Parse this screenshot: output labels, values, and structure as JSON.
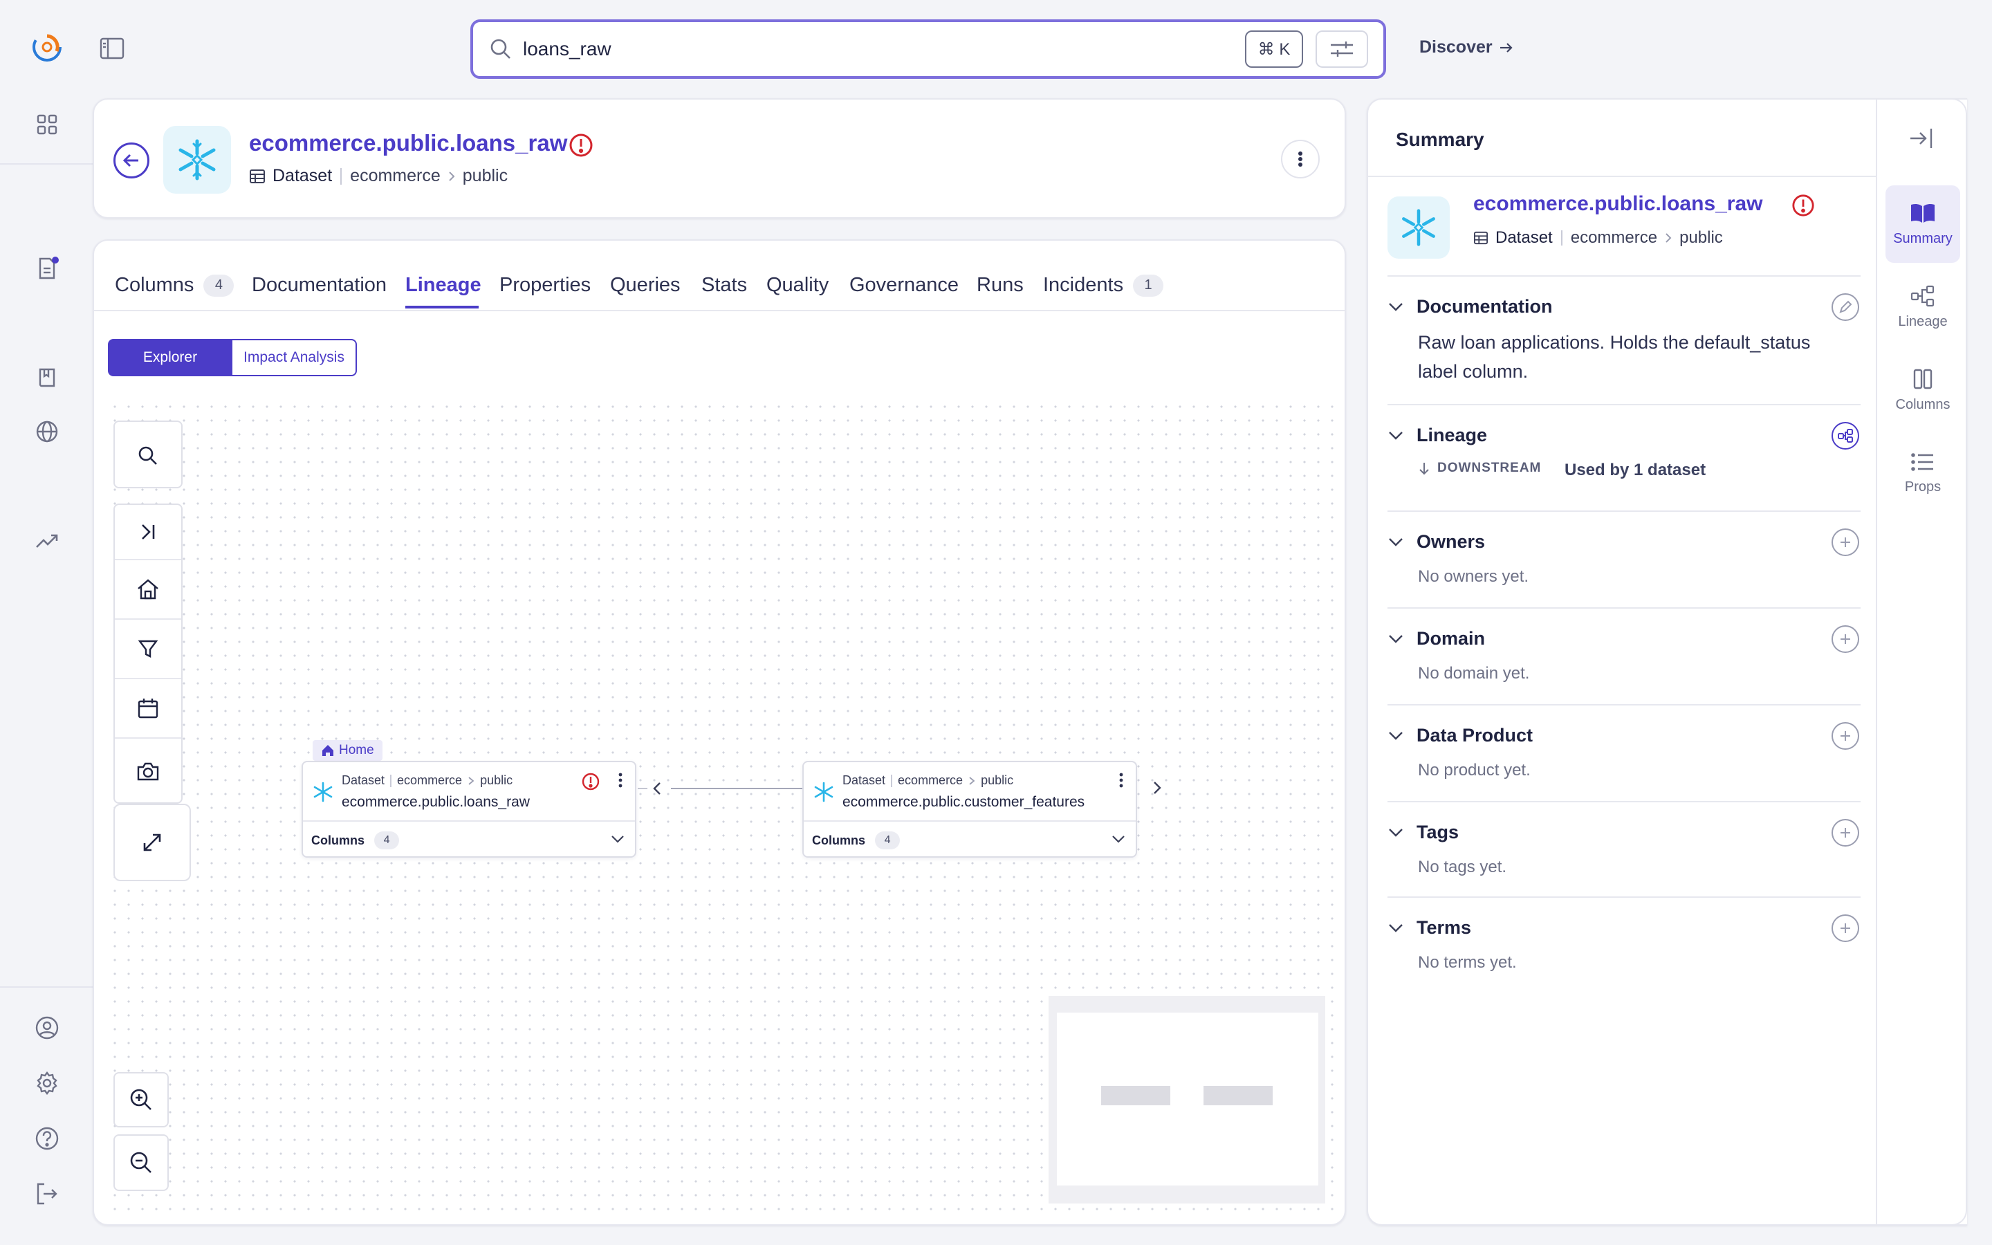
{
  "search": {
    "query": "loans_raw",
    "shortcut": "⌘ K"
  },
  "topbar": {
    "discover_label": "Discover"
  },
  "entity": {
    "title": "ecommerce.public.loans_raw",
    "type": "Dataset",
    "namespace": "ecommerce",
    "schema": "public"
  },
  "tabs": [
    {
      "label": "Columns",
      "count": "4"
    },
    {
      "label": "Documentation"
    },
    {
      "label": "Lineage",
      "active": true
    },
    {
      "label": "Properties"
    },
    {
      "label": "Queries"
    },
    {
      "label": "Stats"
    },
    {
      "label": "Quality"
    },
    {
      "label": "Governance"
    },
    {
      "label": "Runs"
    },
    {
      "label": "Incidents",
      "count": "1"
    }
  ],
  "lineage": {
    "modes": [
      "Explorer",
      "Impact Analysis"
    ],
    "home_tag": "Home",
    "nodes": [
      {
        "type": "Dataset",
        "namespace": "ecommerce",
        "schema": "public",
        "name": "ecommerce.public.loans_raw",
        "columns_label": "Columns",
        "columns_count": "4"
      },
      {
        "type": "Dataset",
        "namespace": "ecommerce",
        "schema": "public",
        "name": "ecommerce.public.customer_features",
        "columns_label": "Columns",
        "columns_count": "4"
      }
    ]
  },
  "summary": {
    "title": "Summary",
    "documentation": {
      "label": "Documentation",
      "text": "Raw loan applications. Holds the default_status label column."
    },
    "lineage": {
      "label": "Lineage",
      "direction": "DOWNSTREAM",
      "used_by": "Used by 1 dataset"
    },
    "owners": {
      "label": "Owners",
      "empty": "No owners yet."
    },
    "domain": {
      "label": "Domain",
      "empty": "No domain yet."
    },
    "data_product": {
      "label": "Data Product",
      "empty": "No product yet."
    },
    "tags": {
      "label": "Tags",
      "empty": "No tags yet."
    },
    "terms": {
      "label": "Terms",
      "empty": "No terms yet."
    }
  },
  "rail": [
    {
      "label": "Summary",
      "icon": "book-icon",
      "active": true
    },
    {
      "label": "Lineage",
      "icon": "lineage-icon"
    },
    {
      "label": "Columns",
      "icon": "columns-icon"
    },
    {
      "label": "Props",
      "icon": "list-icon"
    }
  ],
  "colors": {
    "accent": "#4b3cc7",
    "warning": "#d3262e",
    "snowflake": "#29b5e8"
  }
}
